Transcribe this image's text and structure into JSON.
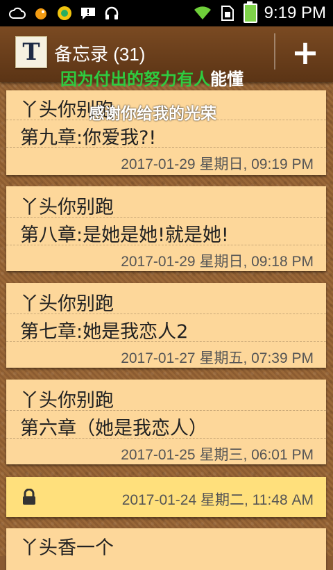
{
  "status_bar": {
    "time": "9:19 PM",
    "icons": [
      "cloud-icon",
      "squirrel-app-icon",
      "media-app-icon",
      "chat-icon",
      "headset-icon",
      "wifi-icon",
      "sim-icon",
      "battery-icon"
    ]
  },
  "action_bar": {
    "app_icon_letter": "T",
    "title": "备忘录 (31)",
    "add_label": "+"
  },
  "overlay_lyrics": {
    "line1_green": "因为付出的努力有人",
    "line1_white": "能懂",
    "line2": "感谢你给我的光荣"
  },
  "notes": [
    {
      "title": "丫头你别跑",
      "subtitle": "第九章:你爱我?!",
      "date": "2017-01-29 星期日, 09:19 PM"
    },
    {
      "title": "丫头你别跑",
      "subtitle": "第八章:是她是她!就是她!",
      "date": "2017-01-29 星期日, 09:18 PM"
    },
    {
      "title": "丫头你别跑",
      "subtitle": "第七章:她是我恋人2",
      "date": "2017-01-27 星期五, 07:39 PM"
    },
    {
      "title": "丫头你别跑",
      "subtitle": "第六章（她是我恋人）",
      "date": "2017-01-25 星期三, 06:01 PM"
    },
    {
      "locked": true,
      "date": "2017-01-24 星期二, 11:48 AM"
    },
    {
      "title": "丫头香一个"
    }
  ],
  "colors": {
    "note_bg": "#fdd79a",
    "locked_note_bg": "#ffe07c",
    "overlay_green": "#2ecc40"
  }
}
